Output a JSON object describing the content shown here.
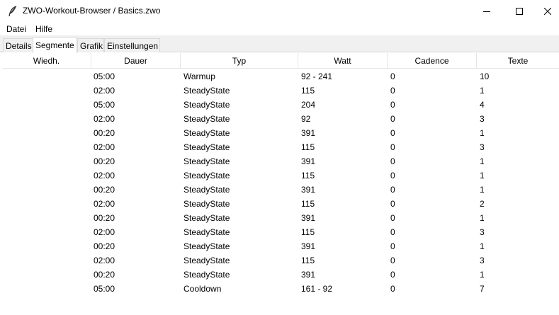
{
  "window": {
    "title": "ZWO-Workout-Browser / Basics.zwo",
    "icon": "feather-icon"
  },
  "menu": {
    "items": [
      "Datei",
      "Hilfe"
    ]
  },
  "tabs": {
    "items": [
      "Details",
      "Segmente",
      "Grafik",
      "Einstellungen"
    ],
    "active": "Segmente"
  },
  "table": {
    "columns": [
      "Wiedh.",
      "Dauer",
      "Typ",
      "Watt",
      "Cadence",
      "Texte"
    ],
    "rows": [
      [
        "",
        "05:00",
        "Warmup",
        "92 - 241",
        "0",
        "10"
      ],
      [
        "",
        "02:00",
        "SteadyState",
        "115",
        "0",
        "1"
      ],
      [
        "",
        "05:00",
        "SteadyState",
        "204",
        "0",
        "4"
      ],
      [
        "",
        "02:00",
        "SteadyState",
        "92",
        "0",
        "3"
      ],
      [
        "",
        "00:20",
        "SteadyState",
        "391",
        "0",
        "1"
      ],
      [
        "",
        "02:00",
        "SteadyState",
        "115",
        "0",
        "3"
      ],
      [
        "",
        "00:20",
        "SteadyState",
        "391",
        "0",
        "1"
      ],
      [
        "",
        "02:00",
        "SteadyState",
        "115",
        "0",
        "1"
      ],
      [
        "",
        "00:20",
        "SteadyState",
        "391",
        "0",
        "1"
      ],
      [
        "",
        "02:00",
        "SteadyState",
        "115",
        "0",
        "2"
      ],
      [
        "",
        "00:20",
        "SteadyState",
        "391",
        "0",
        "1"
      ],
      [
        "",
        "02:00",
        "SteadyState",
        "115",
        "0",
        "3"
      ],
      [
        "",
        "00:20",
        "SteadyState",
        "391",
        "0",
        "1"
      ],
      [
        "",
        "02:00",
        "SteadyState",
        "115",
        "0",
        "3"
      ],
      [
        "",
        "00:20",
        "SteadyState",
        "391",
        "0",
        "1"
      ],
      [
        "",
        "05:00",
        "Cooldown",
        "161 - 92",
        "0",
        "7"
      ]
    ]
  }
}
